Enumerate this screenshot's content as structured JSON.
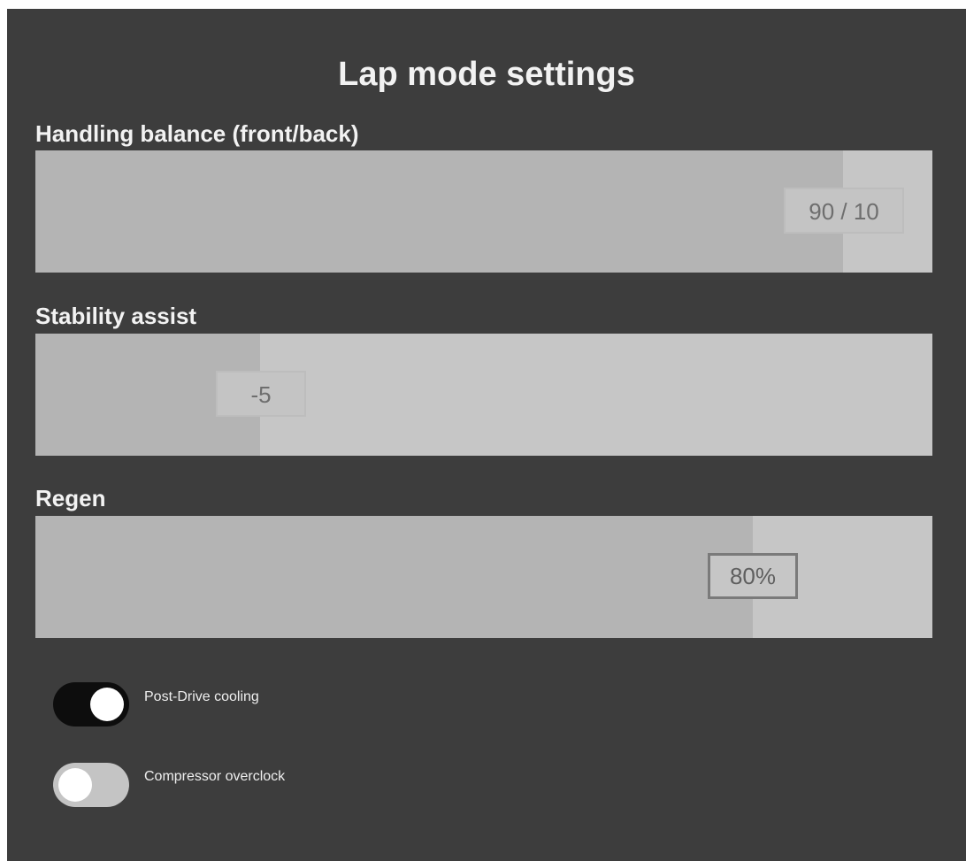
{
  "title": "Lap mode settings",
  "sliders": [
    {
      "label": "Handling balance (front/back)",
      "value_text": "90 / 10",
      "fill_fraction": 0.9
    },
    {
      "label": "Stability assist",
      "value_text": "-5",
      "fill_fraction": 0.25
    },
    {
      "label": "Regen",
      "value_text": "80%",
      "fill_fraction": 0.8
    }
  ],
  "toggles": [
    {
      "label": "Post-Drive cooling",
      "state": "on"
    },
    {
      "label": "Compressor overclock",
      "state": "off"
    }
  ],
  "colors": {
    "panel_background": "#3d3d3d",
    "slider_track": "#c6c6c6",
    "slider_fill": "#b4b4b4",
    "toggle_on": "#0d0d0d",
    "toggle_off": "#c4c4c4"
  }
}
